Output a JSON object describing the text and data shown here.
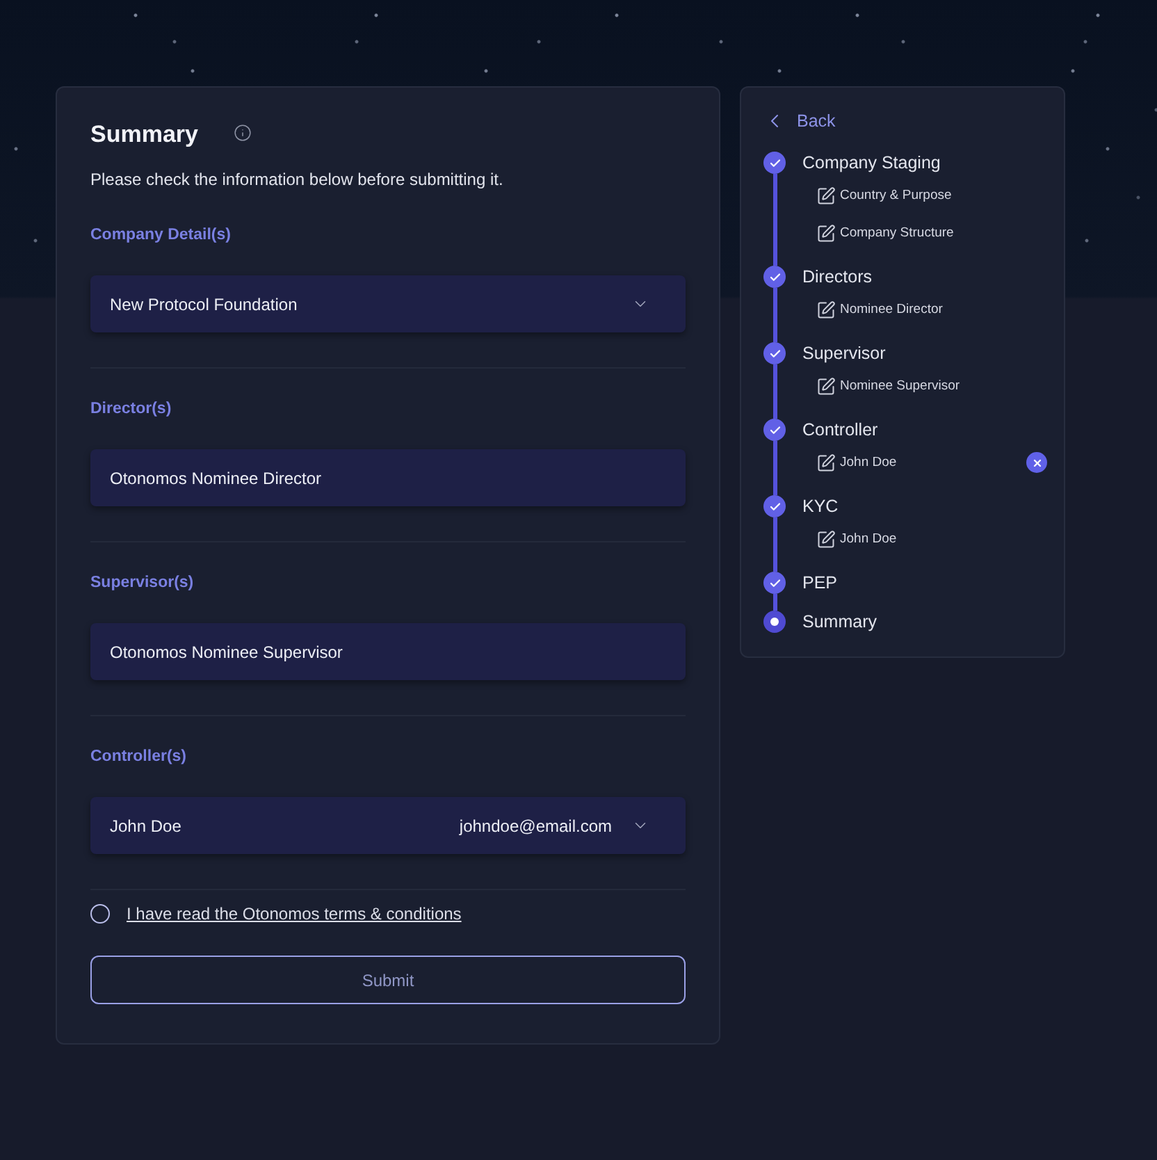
{
  "summary": {
    "title": "Summary",
    "subtitle": "Please check the information below before submitting it."
  },
  "sections": [
    {
      "label": "Company Detail(s)",
      "field": {
        "kind": "select",
        "value": "New Protocol Foundation"
      }
    },
    {
      "label": "Director(s)",
      "field": {
        "kind": "text",
        "value": "Otonomos Nominee Director"
      }
    },
    {
      "label": "Supervisor(s)",
      "field": {
        "kind": "text",
        "value": "Otonomos Nominee Supervisor"
      }
    },
    {
      "label": "Controller(s)",
      "field": {
        "kind": "select",
        "value": "John Doe",
        "email": "johndoe@email.com"
      }
    }
  ],
  "terms": {
    "checked": false,
    "link": "I have read the Otonomos terms & conditions"
  },
  "submit": {
    "label": "Submit"
  },
  "progress": {
    "back": "Back",
    "steps": [
      {
        "label": "Company Staging",
        "done": true,
        "children": [
          {
            "label": "Country & Purpose",
            "removable": false
          },
          {
            "label": "Company Structure",
            "removable": false
          }
        ]
      },
      {
        "label": "Directors",
        "done": true,
        "children": [
          {
            "label": "Nominee Director",
            "removable": false
          }
        ]
      },
      {
        "label": "Supervisor",
        "done": true,
        "children": [
          {
            "label": "Nominee Supervisor",
            "removable": false
          }
        ]
      },
      {
        "label": "Controller",
        "done": true,
        "children": [
          {
            "label": "John Doe",
            "removable": true
          }
        ]
      },
      {
        "label": "KYC",
        "done": true,
        "children": [
          {
            "label": "John Doe",
            "removable": false
          }
        ]
      },
      {
        "label": "PEP",
        "done": true
      },
      {
        "label": "Summary",
        "done": false
      }
    ]
  }
}
